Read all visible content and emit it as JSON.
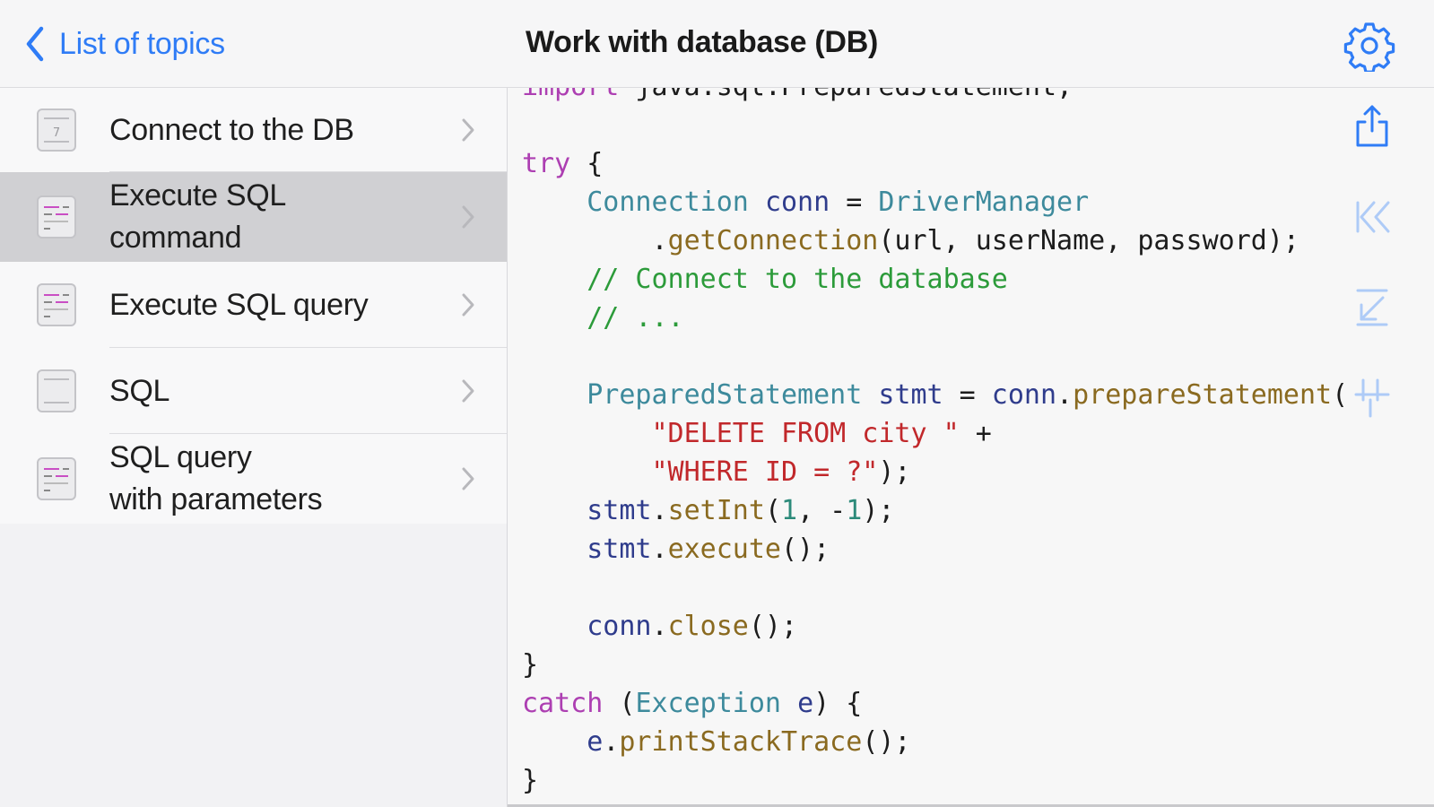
{
  "header": {
    "back_label": "List of topics",
    "title": "Work with database (DB)",
    "icons": {
      "back": "chevron-left-icon",
      "settings": "gear-icon"
    }
  },
  "sidebar": {
    "items": [
      {
        "label": "Connect to the DB",
        "icon": "document-icon",
        "selected": false
      },
      {
        "label": "Execute SQL\ncommand",
        "icon": "code-file-icon",
        "selected": true
      },
      {
        "label": "Execute SQL query",
        "icon": "code-file-icon",
        "selected": false
      },
      {
        "label": "SQL",
        "icon": "document-icon",
        "selected": false
      },
      {
        "label": "SQL query\nwith parameters",
        "icon": "code-file-icon",
        "selected": false
      }
    ]
  },
  "toolbar": {
    "icons": [
      "share-icon",
      "jump-to-start-icon",
      "jump-to-end-icon",
      "pin-icon"
    ]
  },
  "code": {
    "lines": [
      [
        {
          "t": "import",
          "c": "kw"
        },
        {
          "t": " java.sql.PreparedStatement;",
          "c": "plain"
        }
      ],
      [],
      [
        {
          "t": "try",
          "c": "kw"
        },
        {
          "t": " {",
          "c": "plain"
        }
      ],
      [
        {
          "t": "    ",
          "c": "plain"
        },
        {
          "t": "Connection",
          "c": "type"
        },
        {
          "t": " ",
          "c": "plain"
        },
        {
          "t": "conn",
          "c": "var"
        },
        {
          "t": " = ",
          "c": "plain"
        },
        {
          "t": "DriverManager",
          "c": "type"
        }
      ],
      [
        {
          "t": "        .",
          "c": "plain"
        },
        {
          "t": "getConnection",
          "c": "method"
        },
        {
          "t": "(url, userName, password);",
          "c": "plain"
        }
      ],
      [
        {
          "t": "    // Connect to the database",
          "c": "cmt"
        }
      ],
      [
        {
          "t": "    // ...",
          "c": "cmt"
        }
      ],
      [],
      [
        {
          "t": "    ",
          "c": "plain"
        },
        {
          "t": "PreparedStatement",
          "c": "type"
        },
        {
          "t": " ",
          "c": "plain"
        },
        {
          "t": "stmt",
          "c": "var"
        },
        {
          "t": " = ",
          "c": "plain"
        },
        {
          "t": "conn",
          "c": "var"
        },
        {
          "t": ".",
          "c": "plain"
        },
        {
          "t": "prepareStatement",
          "c": "method"
        },
        {
          "t": "(",
          "c": "plain"
        }
      ],
      [
        {
          "t": "        ",
          "c": "plain"
        },
        {
          "t": "\"DELETE FROM city \"",
          "c": "str"
        },
        {
          "t": " +",
          "c": "plain"
        }
      ],
      [
        {
          "t": "        ",
          "c": "plain"
        },
        {
          "t": "\"WHERE ID = ?\"",
          "c": "str"
        },
        {
          "t": ");",
          "c": "plain"
        }
      ],
      [
        {
          "t": "    ",
          "c": "plain"
        },
        {
          "t": "stmt",
          "c": "var"
        },
        {
          "t": ".",
          "c": "plain"
        },
        {
          "t": "setInt",
          "c": "method"
        },
        {
          "t": "(",
          "c": "plain"
        },
        {
          "t": "1",
          "c": "num"
        },
        {
          "t": ", -",
          "c": "plain"
        },
        {
          "t": "1",
          "c": "num"
        },
        {
          "t": ");",
          "c": "plain"
        }
      ],
      [
        {
          "t": "    ",
          "c": "plain"
        },
        {
          "t": "stmt",
          "c": "var"
        },
        {
          "t": ".",
          "c": "plain"
        },
        {
          "t": "execute",
          "c": "method"
        },
        {
          "t": "();",
          "c": "plain"
        }
      ],
      [],
      [
        {
          "t": "    ",
          "c": "plain"
        },
        {
          "t": "conn",
          "c": "var"
        },
        {
          "t": ".",
          "c": "plain"
        },
        {
          "t": "close",
          "c": "method"
        },
        {
          "t": "();",
          "c": "plain"
        }
      ],
      [
        {
          "t": "}",
          "c": "plain"
        }
      ],
      [
        {
          "t": "catch",
          "c": "kw"
        },
        {
          "t": " (",
          "c": "plain"
        },
        {
          "t": "Exception",
          "c": "type"
        },
        {
          "t": " ",
          "c": "plain"
        },
        {
          "t": "e",
          "c": "var"
        },
        {
          "t": ") {",
          "c": "plain"
        }
      ],
      [
        {
          "t": "    ",
          "c": "plain"
        },
        {
          "t": "e",
          "c": "var"
        },
        {
          "t": ".",
          "c": "plain"
        },
        {
          "t": "printStackTrace",
          "c": "method"
        },
        {
          "t": "();",
          "c": "plain"
        }
      ],
      [
        {
          "t": "}",
          "c": "plain"
        }
      ]
    ]
  },
  "colors": {
    "accent": "#2f7cf6",
    "selected_row": "#d0d0d3",
    "keyword": "#ad3fb2",
    "type": "#3d8a9c",
    "comment": "#2c9b3a",
    "string": "#c1282b"
  }
}
